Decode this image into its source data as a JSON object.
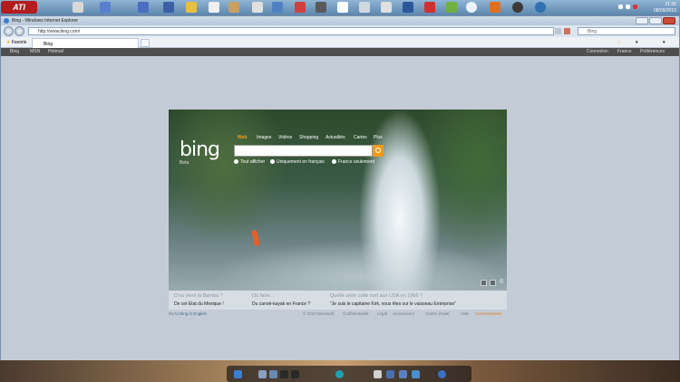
{
  "taskbar": {
    "start_label": "ATI",
    "clock": {
      "time": "21:35",
      "date": "08/09/2010"
    }
  },
  "window": {
    "title": "Bing - Windows Internet Explorer",
    "address": "http://www.bing.com/",
    "search_placeholder": "Bing",
    "favorites_label": "Favoris",
    "tab_label": "Bing"
  },
  "bingbar": {
    "left_links": [
      "Bing",
      "MSN",
      "Hotmail"
    ],
    "right_links": [
      "Connexion",
      "France",
      "Préférences"
    ]
  },
  "hero": {
    "logo": "bing",
    "beta": "Beta",
    "nav": [
      "Web",
      "Images",
      "Vidéos",
      "Shopping",
      "Actualités",
      "Cartes",
      "Plus"
    ],
    "radios": [
      "Tout afficher",
      "Uniquement en français",
      "France seulement"
    ]
  },
  "info": [
    {
      "question": "D'où vient la Bamba ?",
      "answer": "De cet Etat du Mexique !"
    },
    {
      "question": "Où faire...",
      "answer": "Du canoë-kayak en France ?"
    },
    {
      "question": "Quelle série culte sort aux USA en 1966 ?",
      "answer": "\"Je suis le capitaine Kirk, vous êtes sur le vaisseau Enterprise\""
    }
  ],
  "footer": {
    "english": "Go to Bing in English",
    "copyright": "© 2010 Microsoft",
    "links": [
      "Confidentialité",
      "Légal",
      "Annonceurs",
      "Centre d'aide",
      "Aide",
      "Commentaires"
    ]
  },
  "colors": {
    "accent": "#f09a1a",
    "taskbar": "#6b8fb0"
  }
}
